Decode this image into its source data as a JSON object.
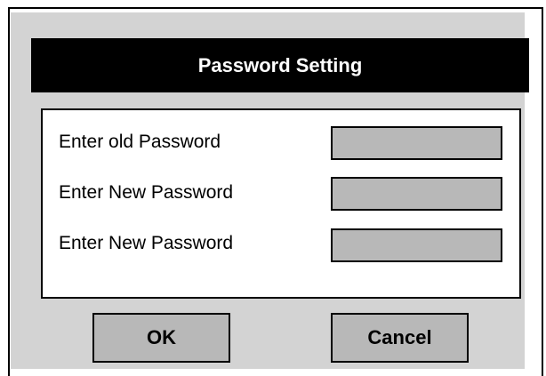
{
  "dialog": {
    "title": "Password Setting",
    "colors": {
      "background": "#d3d3d3",
      "title_bar": "#000000",
      "title_text": "#ffffff",
      "panel": "#ffffff",
      "input_fill": "#b8b8b8",
      "button_fill": "#b8b8b8",
      "border": "#000000"
    }
  },
  "fields": [
    {
      "label": "Enter old Password",
      "value": "",
      "placeholder": ""
    },
    {
      "label": "Enter New Password",
      "value": "",
      "placeholder": ""
    },
    {
      "label": "Enter New Password",
      "value": "",
      "placeholder": ""
    }
  ],
  "buttons": {
    "ok_label": "OK",
    "cancel_label": "Cancel"
  }
}
